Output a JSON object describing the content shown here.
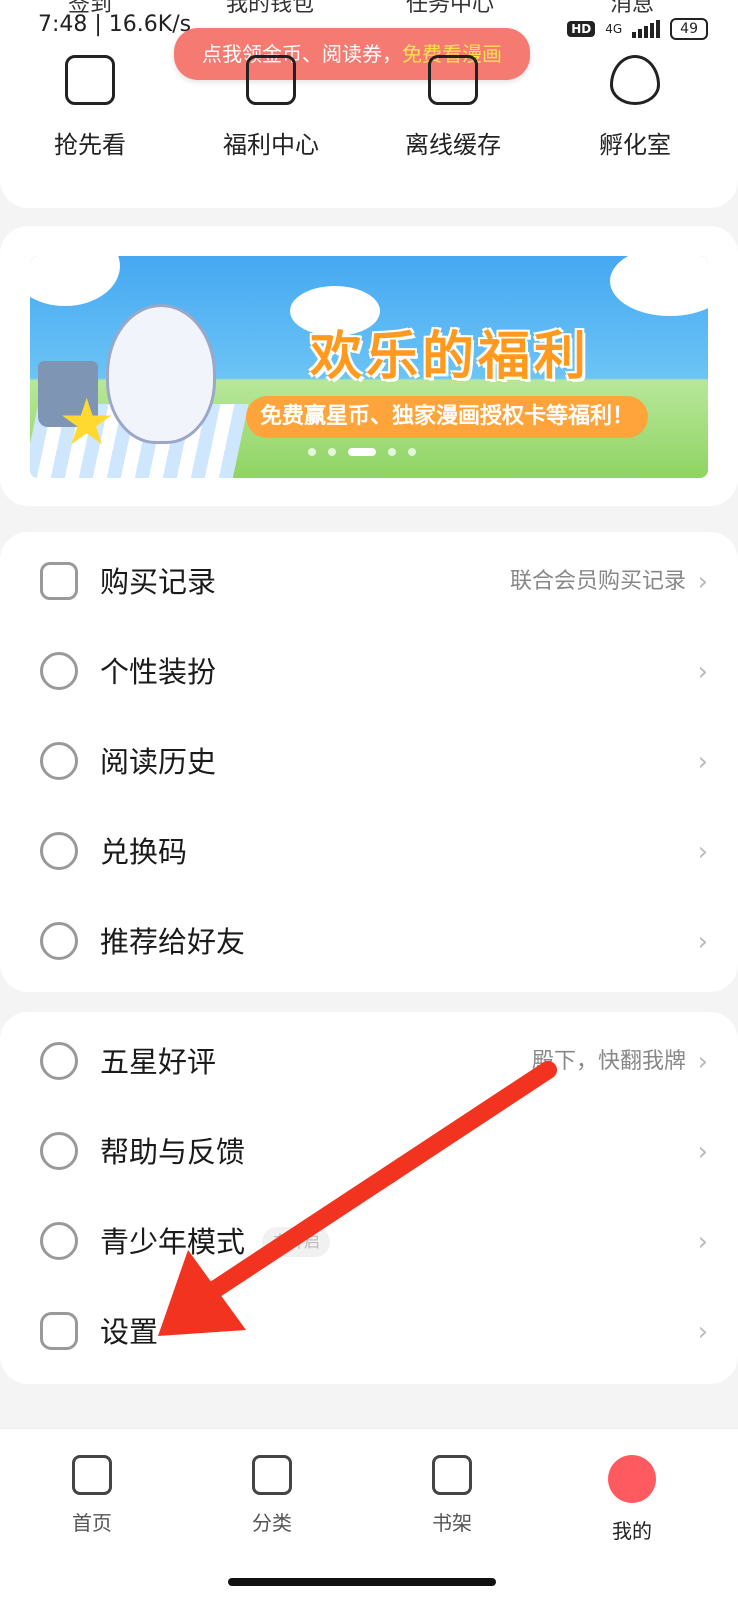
{
  "status_bar": {
    "time_speed": "7:48 | 16.6K/s",
    "hd": "HD",
    "signal": "4G",
    "battery": "49"
  },
  "top_labels": [
    "签到",
    "我的钱包",
    "任务中心",
    "消息"
  ],
  "tooltip": {
    "text": "点我领金币、阅读券，",
    "highlight": "免费看漫画"
  },
  "quick_actions": [
    {
      "label": "抢先看",
      "icon": "lightning-ticket-icon"
    },
    {
      "label": "福利中心",
      "icon": "gift-box-icon"
    },
    {
      "label": "离线缓存",
      "icon": "download-icon"
    },
    {
      "label": "孵化室",
      "icon": "egg-icon"
    }
  ],
  "banner": {
    "title": "欢乐的福利",
    "subtitle": "免费赢星币、独家漫画授权卡等福利！",
    "dots": 5,
    "active_dot": 2
  },
  "list1": [
    {
      "label": "购买记录",
      "right": "联合会员购买记录",
      "icon": "receipt-icon"
    },
    {
      "label": "个性装扮",
      "right": "",
      "icon": "cat-face-icon"
    },
    {
      "label": "阅读历史",
      "right": "",
      "icon": "clock-icon"
    },
    {
      "label": "兑换码",
      "right": "",
      "icon": "redeem-icon"
    },
    {
      "label": "推荐给好友",
      "right": "",
      "icon": "share-arrow-icon"
    }
  ],
  "list2": [
    {
      "label": "五星好评",
      "right": "殿下，快翻我牌",
      "icon": "star-icon"
    },
    {
      "label": "帮助与反馈",
      "right": "",
      "icon": "question-icon"
    },
    {
      "label": "青少年模式",
      "right": "",
      "icon": "umbrella-icon",
      "badge": "未开启"
    },
    {
      "label": "设置",
      "right": "",
      "icon": "settings-hex-icon"
    }
  ],
  "bottom_nav": [
    {
      "label": "首页",
      "icon": "home-icon"
    },
    {
      "label": "分类",
      "icon": "grid-icon"
    },
    {
      "label": "书架",
      "icon": "bookshelf-icon"
    },
    {
      "label": "我的",
      "icon": "profile-icon",
      "active": true
    }
  ],
  "colors": {
    "accent": "#ff5a5f",
    "tooltip_bg": "#f47a72",
    "arrow": "#f2331f"
  }
}
